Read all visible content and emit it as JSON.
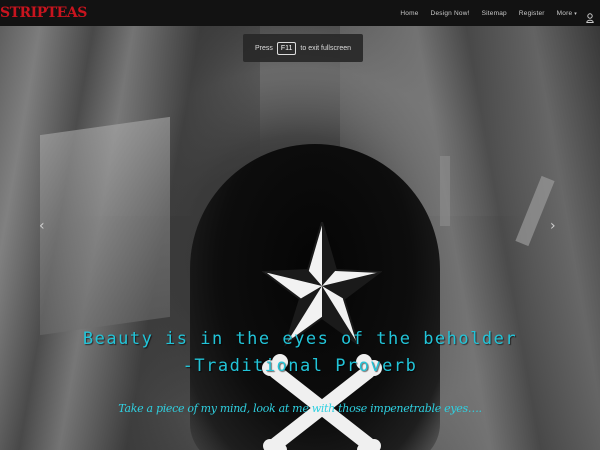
{
  "logo": {
    "text": "STRIPTEAS",
    "color": "#c8141e"
  },
  "nav": {
    "items": [
      {
        "label": "Home"
      },
      {
        "label": "Design Now!"
      },
      {
        "label": "Sitemap"
      },
      {
        "label": "Register"
      },
      {
        "label": "More"
      }
    ],
    "more_caret": "▾",
    "user_icon": "user-icon"
  },
  "toast": {
    "prefix": "Press",
    "key": "F11",
    "suffix": "to exit fullscreen"
  },
  "slider": {
    "prev_arrow": "‹",
    "next_arrow": "›",
    "caption_line1": "Beauty is in the eyes of the beholder",
    "caption_line2": "-Traditional Proverb",
    "subtitle": "Take a piece of my mind, look at me with those impenetrable eyes….",
    "caption_color": "#22c4d8",
    "emblem": "nautical-star-crossbones"
  }
}
